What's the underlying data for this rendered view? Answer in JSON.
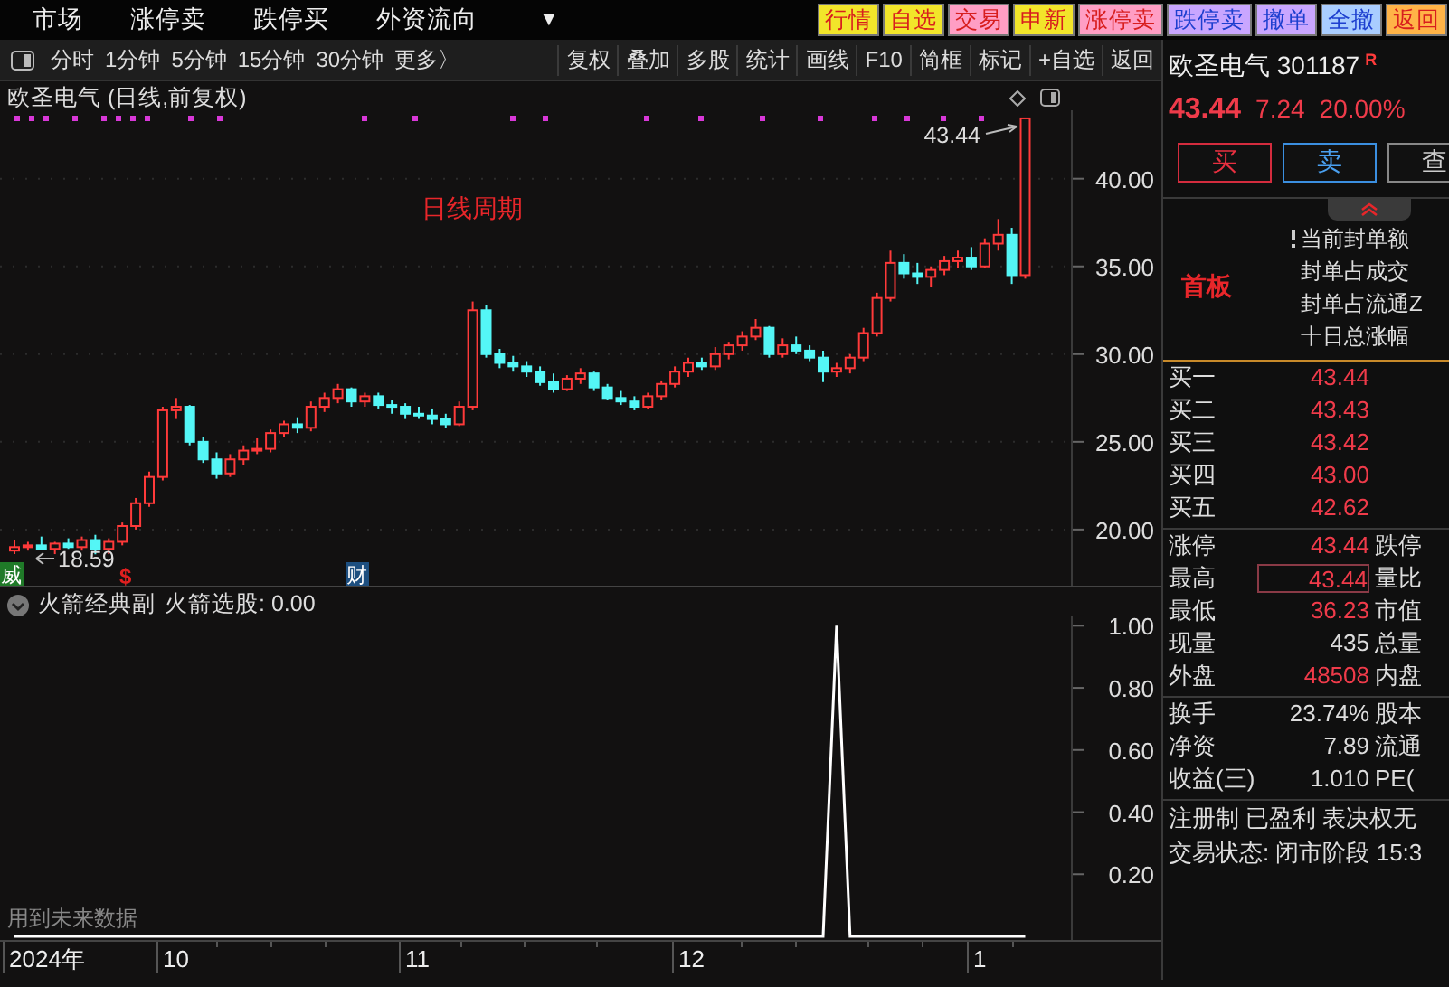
{
  "menu_bar": {
    "items": [
      "市场",
      "涨停卖",
      "跌停买",
      "外资流向"
    ],
    "dropdown": "▼",
    "quick_buttons": [
      {
        "label": "行情",
        "color": "#f2e52a"
      },
      {
        "label": "自选",
        "color": "#f2e52a"
      },
      {
        "label": "交易",
        "color": "#ff9ec4"
      },
      {
        "label": "申新",
        "color": "#f2e52a"
      },
      {
        "label": "涨停卖",
        "color": "#ff9ec4"
      },
      {
        "label": "跌停卖",
        "color": "#c9a6ff"
      },
      {
        "label": "撤单",
        "color": "#c9a6ff"
      },
      {
        "label": "全撤",
        "color": "#a9cdff"
      },
      {
        "label": "返回",
        "color": "#ffb347"
      }
    ]
  },
  "toolbar": {
    "periods": [
      "分时",
      "1分钟",
      "5分钟",
      "15分钟",
      "30分钟",
      "更多〉"
    ],
    "tools": [
      "复权",
      "叠加",
      "多股",
      "统计",
      "画线",
      "F10",
      "简框",
      "标记",
      "+自选",
      "返回"
    ]
  },
  "main_chart": {
    "title": "欧圣电气 (日线,前复权)",
    "period_label": "日线周期",
    "high_label": "43.44",
    "low_label": "18.59",
    "chart_data": {
      "type": "candlestick",
      "grid": true,
      "ylim": [
        16.8,
        43.9
      ],
      "yticks": [
        {
          "value": 40,
          "label": "40.00"
        },
        {
          "value": 35,
          "label": "35.00"
        },
        {
          "value": 30,
          "label": "30.00"
        },
        {
          "value": 25,
          "label": "25.00"
        },
        {
          "value": 20,
          "label": "20.00"
        }
      ],
      "ohlc": [
        [
          18.8,
          19.4,
          18.6,
          19.0
        ],
        [
          19.0,
          19.3,
          18.8,
          19.1
        ],
        [
          19.1,
          19.6,
          18.9,
          18.9
        ],
        [
          18.9,
          19.3,
          18.6,
          19.2
        ],
        [
          19.2,
          19.5,
          18.9,
          19.0
        ],
        [
          19.0,
          19.6,
          18.8,
          19.4
        ],
        [
          19.4,
          19.7,
          18.59,
          18.9
        ],
        [
          18.9,
          19.5,
          18.6,
          19.3
        ],
        [
          19.3,
          20.4,
          19.1,
          20.2
        ],
        [
          20.2,
          21.8,
          20.0,
          21.5
        ],
        [
          21.5,
          23.3,
          21.3,
          23.0
        ],
        [
          23.0,
          27.0,
          22.8,
          26.8
        ],
        [
          26.8,
          27.5,
          26.3,
          27.0
        ],
        [
          27.0,
          27.1,
          24.8,
          25.0
        ],
        [
          25.0,
          25.3,
          23.8,
          24.0
        ],
        [
          24.0,
          24.4,
          22.9,
          23.2
        ],
        [
          23.2,
          24.3,
          23.0,
          24.0
        ],
        [
          24.0,
          24.8,
          23.7,
          24.5
        ],
        [
          24.5,
          25.2,
          24.3,
          24.6
        ],
        [
          24.6,
          25.7,
          24.4,
          25.5
        ],
        [
          25.5,
          26.2,
          25.3,
          26.0
        ],
        [
          26.0,
          26.4,
          25.5,
          25.8
        ],
        [
          25.8,
          27.3,
          25.6,
          27.0
        ],
        [
          27.0,
          27.8,
          26.7,
          27.5
        ],
        [
          27.5,
          28.3,
          27.2,
          28.0
        ],
        [
          28.0,
          28.1,
          27.0,
          27.3
        ],
        [
          27.3,
          27.8,
          27.0,
          27.6
        ],
        [
          27.6,
          27.8,
          26.9,
          27.1
        ],
        [
          27.1,
          27.4,
          26.6,
          27.0
        ],
        [
          27.0,
          27.2,
          26.3,
          26.6
        ],
        [
          26.6,
          27.0,
          26.3,
          26.5
        ],
        [
          26.5,
          26.9,
          26.0,
          26.3
        ],
        [
          26.3,
          26.6,
          25.8,
          26.0
        ],
        [
          26.0,
          27.3,
          25.9,
          27.0
        ],
        [
          27.0,
          33.0,
          26.8,
          32.5
        ],
        [
          32.5,
          32.8,
          29.8,
          30.0
        ],
        [
          30.0,
          30.3,
          29.2,
          29.5
        ],
        [
          29.5,
          29.9,
          29.0,
          29.3
        ],
        [
          29.3,
          29.6,
          28.7,
          29.0
        ],
        [
          29.0,
          29.3,
          28.2,
          28.4
        ],
        [
          28.4,
          28.9,
          27.8,
          28.0
        ],
        [
          28.0,
          28.8,
          27.9,
          28.6
        ],
        [
          28.6,
          29.2,
          28.3,
          28.9
        ],
        [
          28.9,
          29.0,
          27.9,
          28.1
        ],
        [
          28.1,
          28.3,
          27.4,
          27.5
        ],
        [
          27.5,
          27.9,
          27.1,
          27.3
        ],
        [
          27.3,
          27.6,
          26.8,
          27.0
        ],
        [
          27.0,
          27.8,
          26.9,
          27.6
        ],
        [
          27.6,
          28.5,
          27.4,
          28.3
        ],
        [
          28.3,
          29.3,
          28.1,
          29.0
        ],
        [
          29.0,
          29.8,
          28.7,
          29.5
        ],
        [
          29.5,
          29.8,
          29.1,
          29.3
        ],
        [
          29.3,
          30.4,
          29.1,
          30.0
        ],
        [
          30.0,
          30.7,
          29.7,
          30.5
        ],
        [
          30.5,
          31.3,
          30.2,
          31.0
        ],
        [
          31.0,
          32.0,
          30.8,
          31.5
        ],
        [
          31.5,
          31.6,
          29.8,
          30.0
        ],
        [
          30.0,
          30.9,
          29.8,
          30.5
        ],
        [
          30.5,
          31.0,
          30.0,
          30.2
        ],
        [
          30.2,
          30.5,
          29.6,
          29.8
        ],
        [
          29.8,
          30.2,
          28.4,
          29.0
        ],
        [
          29.0,
          29.5,
          28.7,
          29.2
        ],
        [
          29.2,
          30.0,
          28.9,
          29.8
        ],
        [
          29.8,
          31.5,
          29.6,
          31.2
        ],
        [
          31.2,
          33.5,
          31.0,
          33.2
        ],
        [
          33.2,
          35.9,
          33.0,
          35.2
        ],
        [
          35.2,
          35.7,
          34.3,
          34.6
        ],
        [
          34.6,
          35.2,
          34.0,
          34.4
        ],
        [
          34.4,
          35.0,
          33.8,
          34.8
        ],
        [
          34.8,
          35.6,
          34.5,
          35.3
        ],
        [
          35.3,
          35.9,
          34.9,
          35.5
        ],
        [
          35.5,
          36.1,
          34.8,
          35.0
        ],
        [
          35.0,
          36.6,
          34.9,
          36.3
        ],
        [
          36.3,
          37.7,
          35.9,
          36.8
        ],
        [
          36.8,
          37.2,
          34.0,
          34.5
        ],
        [
          34.5,
          43.44,
          34.3,
          43.44
        ]
      ]
    },
    "event_marks": [
      {
        "text": "威",
        "kind": "filled",
        "color": "#1f7a28"
      },
      {
        "text": "$",
        "kind": "plain",
        "color": "#e02020"
      },
      {
        "text": "财",
        "kind": "filled",
        "color": "#1d4f80"
      }
    ]
  },
  "indicator": {
    "name": "火箭经典副",
    "reading": "火箭选股: 0.00",
    "note": "用到未来数据",
    "chart_data": {
      "type": "line",
      "ylim": [
        0,
        1.03
      ],
      "yticks": [
        {
          "value": 0.2,
          "label": "0.20"
        },
        {
          "value": 0.4,
          "label": "0.40"
        },
        {
          "value": 0.6,
          "label": "0.60"
        },
        {
          "value": 0.8,
          "label": "0.80"
        },
        {
          "value": 1,
          "label": "1.00"
        }
      ],
      "series": [
        {
          "color": "#ffffff",
          "values": [
            0,
            0,
            0,
            0,
            0,
            0,
            0,
            0,
            0,
            0,
            0,
            0,
            0,
            0,
            0,
            0,
            0,
            0,
            0,
            0,
            0,
            0,
            0,
            0,
            0,
            0,
            0,
            0,
            0,
            0,
            0,
            0,
            0,
            0,
            0,
            0,
            0,
            0,
            0,
            0,
            0,
            0,
            0,
            0,
            0,
            0,
            0,
            0,
            0,
            0,
            0,
            0,
            0,
            0,
            0,
            0,
            0,
            0,
            0,
            0,
            0,
            1,
            0,
            0,
            0,
            0,
            0,
            0,
            0,
            0,
            0,
            0,
            0,
            0,
            0,
            0
          ]
        }
      ]
    }
  },
  "time_axis": [
    "2024年",
    "10",
    "11",
    "12",
    "1"
  ],
  "quote": {
    "name": "欧圣电气",
    "code": "301187",
    "badge": "R",
    "price": "43.44",
    "change": "7.24",
    "change_pct": "20.00%"
  },
  "trade_buttons": [
    {
      "label": "买",
      "kind": "buy"
    },
    {
      "label": "卖",
      "kind": "sell"
    },
    {
      "label": "查",
      "kind": "query"
    }
  ],
  "limit_info": {
    "tag": "首板",
    "items": [
      "当前封单额",
      "封单占成交",
      "封单占流通Z",
      "十日总涨幅"
    ]
  },
  "bids": [
    {
      "label": "买一",
      "price": "43.44"
    },
    {
      "label": "买二",
      "price": "43.43"
    },
    {
      "label": "买三",
      "price": "43.42"
    },
    {
      "label": "买四",
      "price": "43.00"
    },
    {
      "label": "买五",
      "price": "42.62"
    }
  ],
  "stats": [
    {
      "label": "涨停",
      "value": "43.44",
      "label2": "跌停",
      "kind": "up",
      "highlighted": false
    },
    {
      "label": "最高",
      "value": "43.44",
      "label2": "量比",
      "kind": "up",
      "highlighted": true
    },
    {
      "label": "最低",
      "value": "36.23",
      "label2": "市值",
      "kind": "up",
      "highlighted": false
    },
    {
      "label": "现量",
      "value": "435",
      "label2": "总量",
      "kind": "plain",
      "highlighted": false
    },
    {
      "label": "外盘",
      "value": "48508",
      "label2": "内盘",
      "kind": "up",
      "highlighted": false
    }
  ],
  "fundamentals": [
    {
      "label": "换手",
      "value": "23.74%",
      "label2": "股本"
    },
    {
      "label": "净资",
      "value": "7.89",
      "label2": "流通"
    },
    {
      "label": "收益(三)",
      "value": "1.010",
      "label2": "PE("
    }
  ],
  "tags_line": "注册制 已盈利 表决权无",
  "trade_status": "交易状态: 闭市阶段 15:3"
}
